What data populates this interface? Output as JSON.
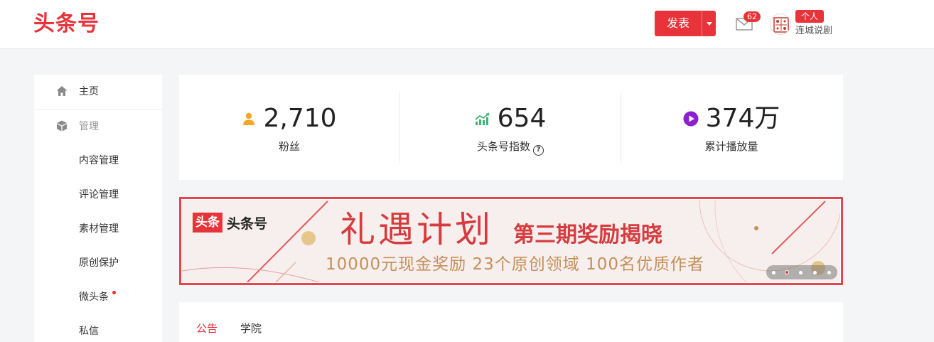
{
  "header": {
    "logo": "头条号",
    "publish_label": "发表",
    "mail_count": "62",
    "account_badge": "个人",
    "account_name": "连城说剧"
  },
  "sidebar": {
    "items": [
      {
        "label": "主页",
        "icon": "home-icon"
      },
      {
        "label": "管理",
        "icon": "cube-icon"
      },
      {
        "label": "内容管理"
      },
      {
        "label": "评论管理"
      },
      {
        "label": "素材管理"
      },
      {
        "label": "原创保护"
      },
      {
        "label": "微头条",
        "dot": true
      },
      {
        "label": "私信"
      }
    ]
  },
  "stats": [
    {
      "value": "2,710",
      "label": "粉丝",
      "icon": "user-icon",
      "color": "#f5a623"
    },
    {
      "value": "654",
      "label": "头条号指数",
      "icon": "trend-icon",
      "color": "#3cb371",
      "help": "?"
    },
    {
      "value": "374万",
      "label": "累计播放量",
      "icon": "play-icon",
      "color": "#8b1fd1"
    }
  ],
  "banner": {
    "logo_box": "头条",
    "logo_text": "头条号",
    "title": "礼遇计划",
    "subtitle": "第三期奖励揭晓",
    "line": "10000元现金奖励  23个原创领域  100名优质作者"
  },
  "notice": {
    "tabs": [
      "公告",
      "学院"
    ],
    "active_tab": 0
  },
  "colors": {
    "brand": "#e8333a",
    "banner_accent": "#d63b3f",
    "banner_gold": "#c4905a"
  }
}
